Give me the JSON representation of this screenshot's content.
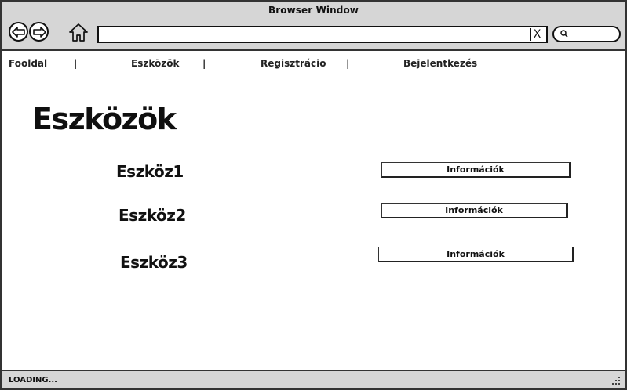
{
  "window": {
    "title": "Browser Window"
  },
  "toolbar": {
    "back_icon": "back-arrow-icon",
    "forward_icon": "forward-arrow-icon",
    "home_icon": "home-icon",
    "url_value": "",
    "clear_label": "X",
    "search_icon": "search-icon"
  },
  "menu": {
    "items": [
      {
        "label": "Fooldal"
      },
      {
        "label": "Eszközök"
      },
      {
        "label": "Regisztrácio"
      },
      {
        "label": "Bejelentkezés"
      }
    ],
    "separator": "|"
  },
  "page": {
    "title": "Eszközök",
    "tools": [
      {
        "name": "Eszköz1",
        "button_label": "Információk"
      },
      {
        "name": "Eszköz2",
        "button_label": "Információk"
      },
      {
        "name": "Eszköz3",
        "button_label": "Információk"
      }
    ]
  },
  "status": {
    "text": "LOADING..."
  },
  "colors": {
    "chrome_bg": "#d6d6d6",
    "border": "#333333",
    "text": "#111111"
  }
}
